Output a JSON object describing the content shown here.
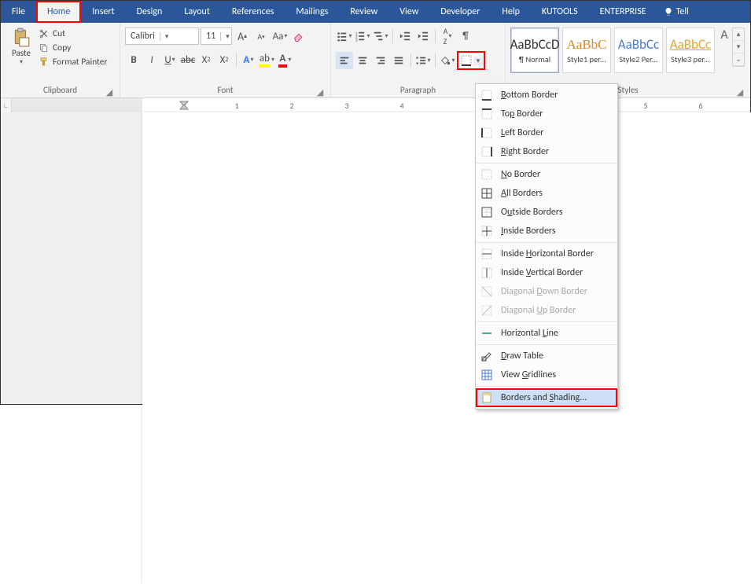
{
  "tabs": [
    "File",
    "Home",
    "Insert",
    "Design",
    "Layout",
    "References",
    "Mailings",
    "Review",
    "View",
    "Developer",
    "Help",
    "KUTOOLS",
    "ENTERPRISE"
  ],
  "tell": "Tell",
  "clipboard": {
    "paste": "Paste",
    "cut": "Cut",
    "copy": "Copy",
    "fmt": "Format Painter",
    "label": "Clipboard"
  },
  "font": {
    "name": "Calibri",
    "size": "11",
    "label": "Font"
  },
  "paragraph": {
    "label": "Paragraph"
  },
  "styles": {
    "label": "Styles",
    "items": [
      {
        "preview": "AaBbCcD",
        "name": "¶ Normal",
        "color": "#333333"
      },
      {
        "preview": "AaBbC",
        "name": "Style1 per...",
        "color": "#e08427"
      },
      {
        "preview": "AaBbCc",
        "name": "Style2 Per...",
        "color": "#4a7bd0"
      },
      {
        "preview": "AaBbCc",
        "name": "Style3 per...",
        "color": "#e8a23b"
      }
    ]
  },
  "ruler": {
    "ticks": [
      "1",
      "2",
      "3",
      "4",
      "5",
      "6"
    ]
  },
  "border_menu": {
    "items": [
      {
        "label": "Bottom Border",
        "u": 0
      },
      {
        "label": "Top Border",
        "u": 2
      },
      {
        "label": "Left Border",
        "u": 0
      },
      {
        "label": "Right Border",
        "u": 0
      },
      {
        "sep": true
      },
      {
        "label": "No Border",
        "u": 0
      },
      {
        "label": "All Borders",
        "u": 0
      },
      {
        "label": "Outside Borders",
        "u": 1
      },
      {
        "label": "Inside Borders",
        "u": 0
      },
      {
        "sep": true
      },
      {
        "label": "Inside Horizontal Border",
        "u": 7
      },
      {
        "label": "Inside Vertical Border",
        "u": 7
      },
      {
        "label": "Diagonal Down Border",
        "u": 9,
        "disabled": true
      },
      {
        "label": "Diagonal Up Border",
        "u": 9,
        "disabled": true
      },
      {
        "sep": true
      },
      {
        "label": "Horizontal Line",
        "u": 11
      },
      {
        "sep": true
      },
      {
        "label": "Draw Table",
        "u": 0
      },
      {
        "label": "View Gridlines",
        "u": 5
      },
      {
        "sep": true
      },
      {
        "label": "Borders and Shading...",
        "u": 12,
        "hl": true,
        "redbox": true
      }
    ]
  }
}
